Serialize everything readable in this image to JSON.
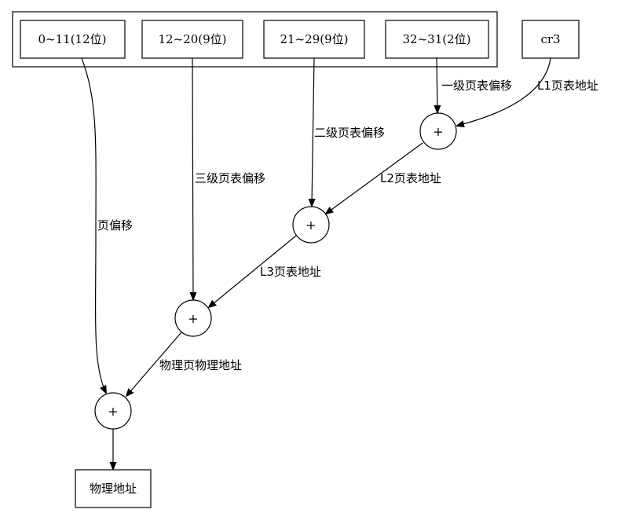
{
  "address_fields": [
    {
      "id": "bits-0-11",
      "label": "0~11(12位)"
    },
    {
      "id": "bits-12-20",
      "label": "12~20(9位)"
    },
    {
      "id": "bits-21-29",
      "label": "21~29(9位)"
    },
    {
      "id": "bits-32-31",
      "label": "32~31(2位)"
    }
  ],
  "register": {
    "label": "cr3"
  },
  "adders": [
    {
      "id": "adder-1",
      "symbol": "+"
    },
    {
      "id": "adder-2",
      "symbol": "+"
    },
    {
      "id": "adder-3",
      "symbol": "+"
    },
    {
      "id": "adder-4",
      "symbol": "+"
    }
  ],
  "result": {
    "label": "物理地址"
  },
  "edge_labels": {
    "l1_offset": "一级页表偏移",
    "l1_address": "L1页表地址",
    "l2_offset": "二级页表偏移",
    "l2_address": "L2页表地址",
    "l3_offset": "三级页表偏移",
    "l3_address": "L3页表地址",
    "page_offset": "页偏移",
    "physical_page_address": "物理页物理地址"
  }
}
